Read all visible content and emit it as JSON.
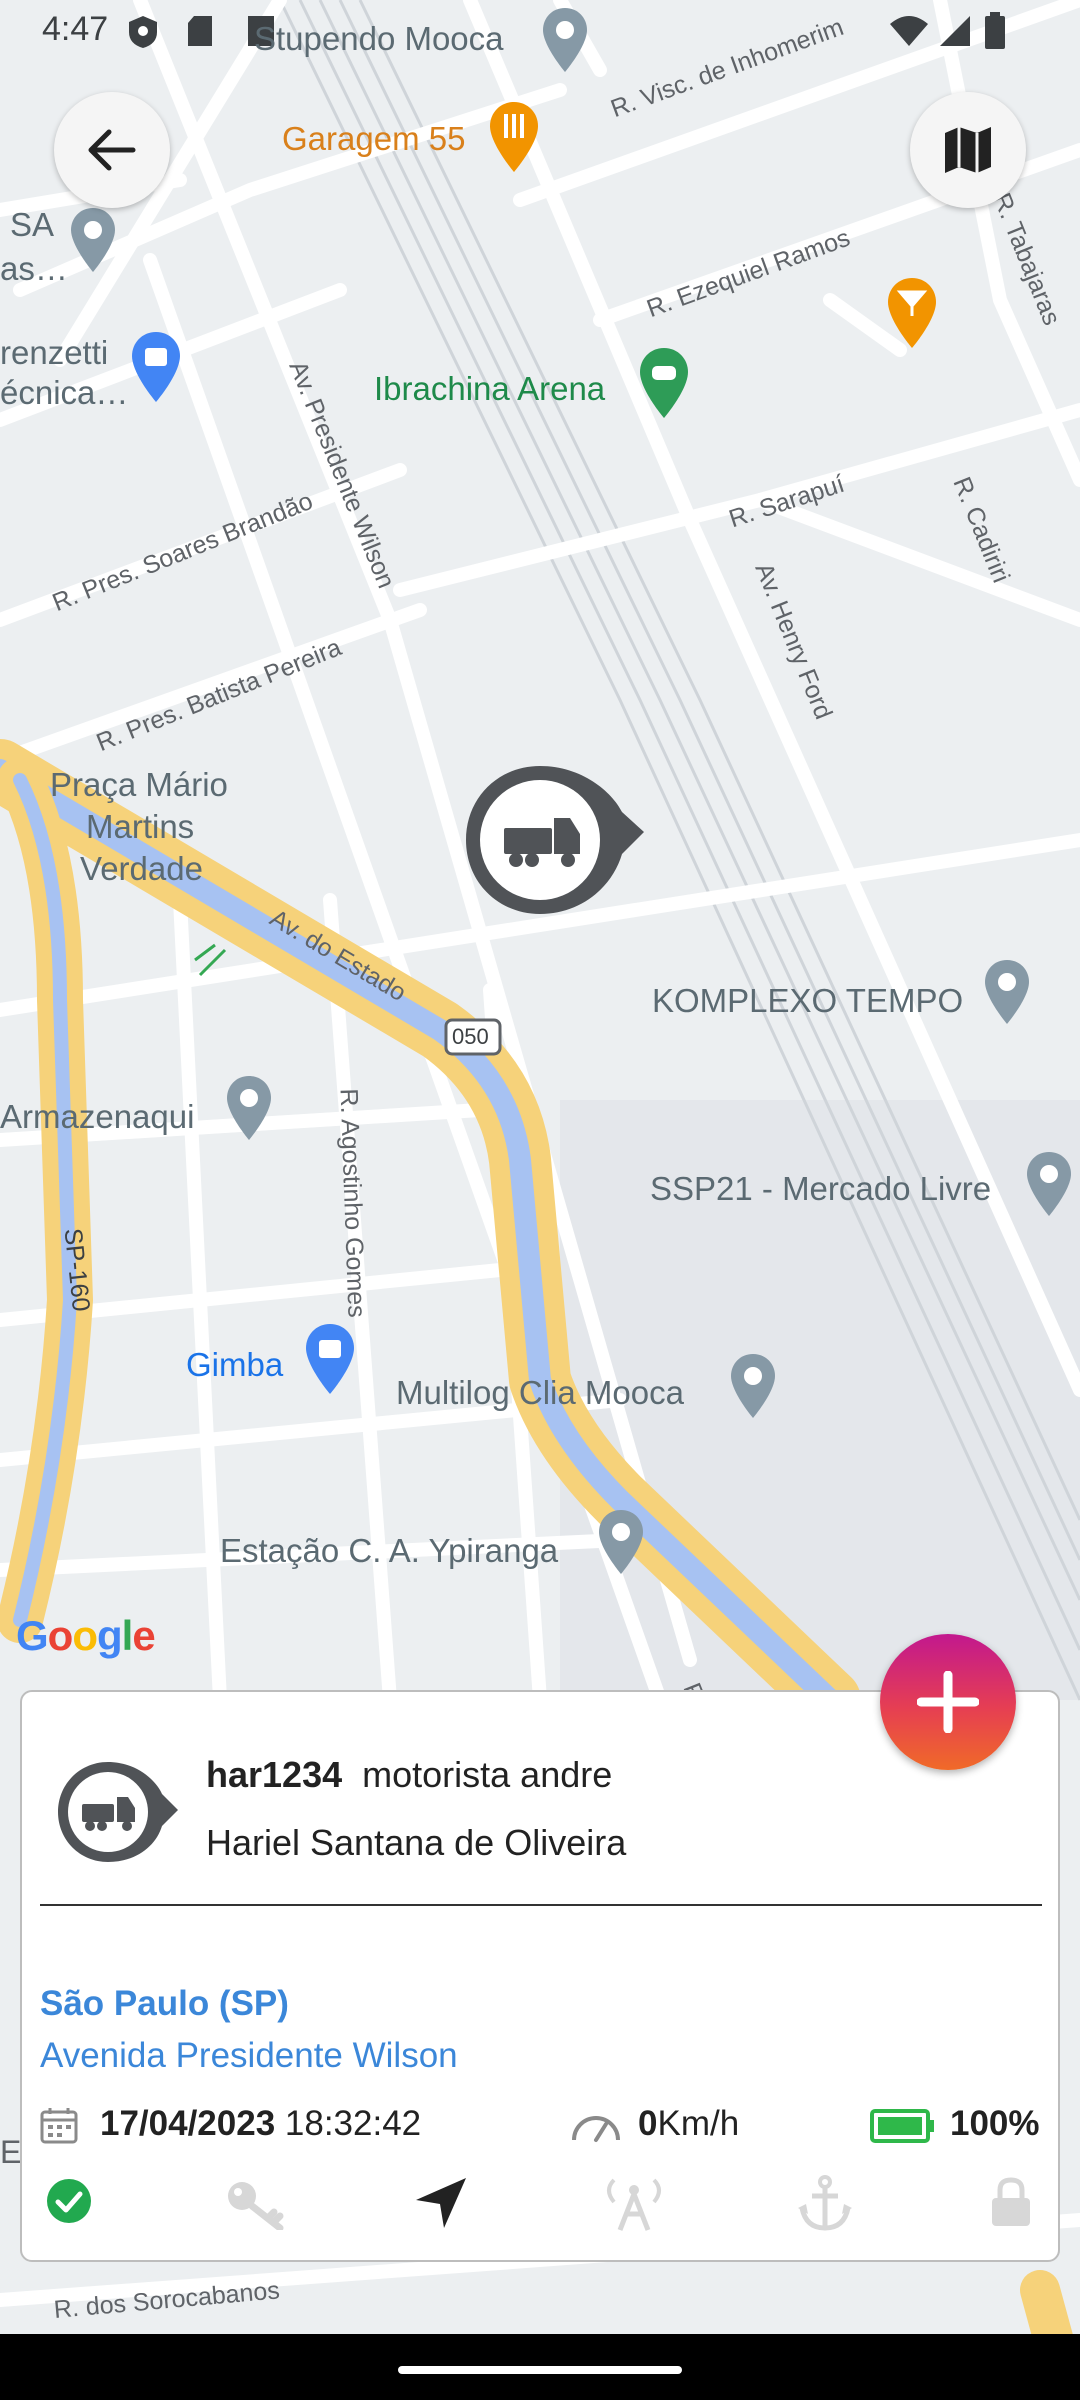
{
  "status_bar": {
    "time": "4:47"
  },
  "map": {
    "pois": {
      "stupendo": "Stupendo Mooca",
      "garagem": "Garagem 55",
      "sa_1": "SA",
      "sa_2": "as…",
      "renzetti_1": "renzetti",
      "renzetti_2": "écnica…",
      "ibrachina": "Ibrachina Arena",
      "praca_1": "Praça Mário",
      "praca_2": "Martins",
      "praca_3": "Verdade",
      "komplexo": "KOMPLEXO TEMPO",
      "armazenaqui": "Armazenaqui",
      "ssp21": "SSP21 - Mercado Livre",
      "gimba": "Gimba",
      "multilog": "Multilog Clia Mooca",
      "estacao": "Estação C. A. Ypiranga"
    },
    "streets": {
      "visc": "R. Visc. de Inhomerim",
      "tabajaras": "R. Tabajaras",
      "ezequiel": "R. Ezequiel Ramos",
      "pres_wilson": "Av. Presidente Wilson",
      "soares": "R. Pres. Soares Brandão",
      "sarapui": "R. Sarapuí",
      "cadiriri": "R. Cadiriri",
      "henry_ford": "Av. Henry Ford",
      "batista": "R. Pres. Batista Pereira",
      "estado": "Av. do Estado",
      "shield_050": "050",
      "agostinho": "R. Agostinho Gomes",
      "sp160": "SP-160",
      "sorocabanos": "R. dos Sorocabanos",
      "r_partial": "R",
      "e_partial": "E"
    },
    "google": {
      "g1": "G",
      "o1": "o",
      "o2": "o",
      "g2": "g",
      "l": "l",
      "e": "e"
    }
  },
  "vehicle_card": {
    "plate": "har1234",
    "vehicle_name": "motorista andre",
    "driver": "Hariel Santana de Oliveira",
    "city": "São Paulo (SP)",
    "street": "Avenida Presidente Wilson",
    "date": "17/04/2023",
    "time": "18:32:42",
    "speed_value": "0",
    "speed_unit": "Km/h",
    "battery": "100%"
  },
  "icons": {
    "back": "arrow-left-icon",
    "map_type": "map-icon",
    "fab": "plus-icon",
    "truck": "truck-icon",
    "calendar": "calendar-icon",
    "speed": "speedometer-icon",
    "battery": "battery-icon",
    "status_ok": "check-circle-icon",
    "ignition": "key-icon",
    "gps": "navigation-icon",
    "signal": "antenna-icon",
    "anchor": "anchor-icon",
    "lock": "lock-icon"
  },
  "colors": {
    "accent_blue": "#3b87d9",
    "ok_green": "#22a94f",
    "battery_green": "#2fb84a",
    "highway_yellow": "#f6d27a",
    "highway_blue": "#a7c2f2",
    "fab_top": "#c2188e",
    "fab_bottom": "#f06a28"
  }
}
